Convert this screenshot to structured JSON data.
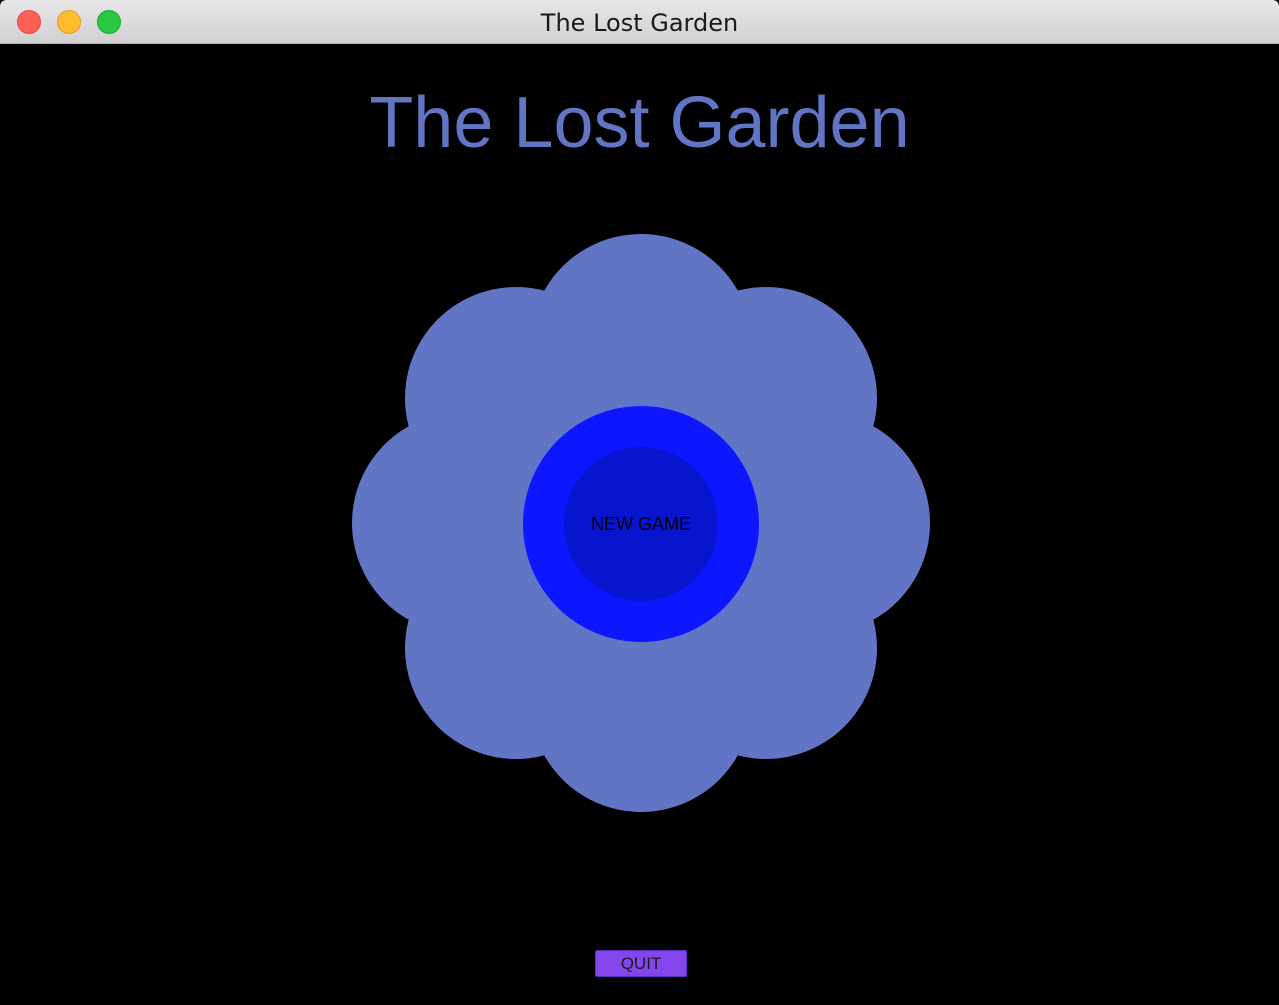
{
  "window": {
    "title": "The Lost Garden"
  },
  "game": {
    "title": "The Lost Garden",
    "new_game_label": "NEW GAME",
    "quit_label": "QUIT"
  },
  "colors": {
    "background": "#000000",
    "title_text": "#6275c4",
    "petals": "#6275c4",
    "center_outer_ring": "#0d17ff",
    "center_inner": "#0815cf",
    "quit_button": "#8446ec"
  }
}
